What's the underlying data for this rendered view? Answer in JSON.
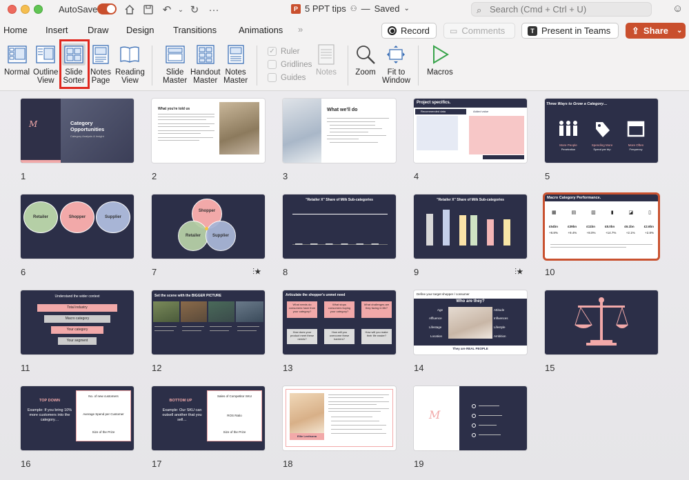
{
  "titlebar": {
    "autosave_label": "AutoSave",
    "doc_title": "5 PPT tips",
    "saved_status": "Saved",
    "search_placeholder": "Search (Cmd + Ctrl + U)"
  },
  "tabs": [
    "Home",
    "Insert",
    "Draw",
    "Design",
    "Transitions",
    "Animations"
  ],
  "actions": {
    "record": "Record",
    "comments": "Comments",
    "teams": "Present in Teams",
    "share": "Share"
  },
  "ribbon": {
    "normal": "Normal",
    "outline_view_1": "Outline",
    "outline_view_2": "View",
    "slide_sorter_1": "Slide",
    "slide_sorter_2": "Sorter",
    "notes_page_1": "Notes",
    "notes_page_2": "Page",
    "reading_view_1": "Reading",
    "reading_view_2": "View",
    "slide_master_1": "Slide",
    "slide_master_2": "Master",
    "handout_master_1": "Handout",
    "handout_master_2": "Master",
    "notes_master_1": "Notes",
    "notes_master_2": "Master",
    "ruler": "Ruler",
    "gridlines": "Gridlines",
    "guides": "Guides",
    "notes": "Notes",
    "zoom": "Zoom",
    "fit_1": "Fit to",
    "fit_2": "Window",
    "macros": "Macros"
  },
  "slides": {
    "s1_title": "Category Opportunities",
    "s1_sub": "Category Analysis & Insight",
    "s2_title": "What you're told us",
    "s3_title": "What we'll do",
    "s4_title": "Project specifics.",
    "s4_a": "Recommended data",
    "s4_b": "Added value",
    "s5_title": "Three Ways to Grow a Category…",
    "s5_a": "More People",
    "s5_a2": "Penetration",
    "s5_b": "Spending More",
    "s5_b2": "Spend per trip",
    "s5_c": "More Often",
    "s5_c2": "Frequency",
    "s6_a": "Retailer",
    "s6_b": "Shopper",
    "s6_c": "Supplier",
    "s7_a": "Shopper",
    "s7_b": "Retailer",
    "s7_c": "Supplier",
    "s8_title": "\"Retailer X\" Share of Milk Sub-categories",
    "s9_title": "\"Retailer X\" Share of Milk Sub-categories",
    "s10_title": "Macro Category Performance.",
    "s10_v1": "£54bn",
    "s10_v2": "£39bn",
    "s10_v3": "£11bn",
    "s10_v4": "£8.0bn",
    "s10_v5": "£6.1bn",
    "s10_v6": "£2.6bn",
    "s10_p1": "+8.8%",
    "s10_p2": "+9.4%",
    "s10_p3": "+8.0%",
    "s10_p4": "+14.7%",
    "s10_p5": "+2.1%",
    "s10_p6": "+2.8%",
    "s11_title": "Understand the wider context",
    "s11_a": "Total industry",
    "s11_b": "Macro category",
    "s11_c": "Your category",
    "s11_d": "Your segment",
    "s12_title": "Set the scene with the BIGGER PICTURE",
    "s13_title": "Articulate the shopper's unmet need",
    "s13_a": "What needs do consumers have from your category?",
    "s13_b": "What stops consumers buying your category?",
    "s13_c": "What challenges are they facing in life?",
    "s13_d": "How does your product meet these needs?",
    "s13_e": "How will you overcome these barriers?",
    "s13_f": "How will you make their life easier?",
    "s14_title": "Define your target shopper / consumer",
    "s14_sub": "Who are they?",
    "s14_a": "Age",
    "s14_b": "Affluence",
    "s14_c": "Lifestage",
    "s14_d": "Location",
    "s14_e": "Attitude",
    "s14_f": "Influences",
    "s14_g": "Lifestyle",
    "s14_h": "Ambition",
    "s14_foot": "They are REAL PEOPLE",
    "s16_a": "TOP DOWN",
    "s16_b": "Example: If you bring 10% more customers into the category…",
    "s16_c": "No. of new customers",
    "s16_d": "Average Spend per Customer",
    "s16_e": "Size of the Prize",
    "s17_a": "BOTTOM UP",
    "s17_b": "Example: Our SKU can outsell another that you sell…",
    "s17_c": "Sales of Competitor SKU",
    "s17_d": "ROS Ratio",
    "s17_e": "Size of the Prize",
    "s18_name": "Ellie Levitsona"
  },
  "slide_numbers": [
    "1",
    "2",
    "3",
    "4",
    "5",
    "6",
    "7",
    "8",
    "9",
    "10",
    "11",
    "12",
    "13",
    "14",
    "15",
    "16",
    "17",
    "18",
    "19"
  ]
}
